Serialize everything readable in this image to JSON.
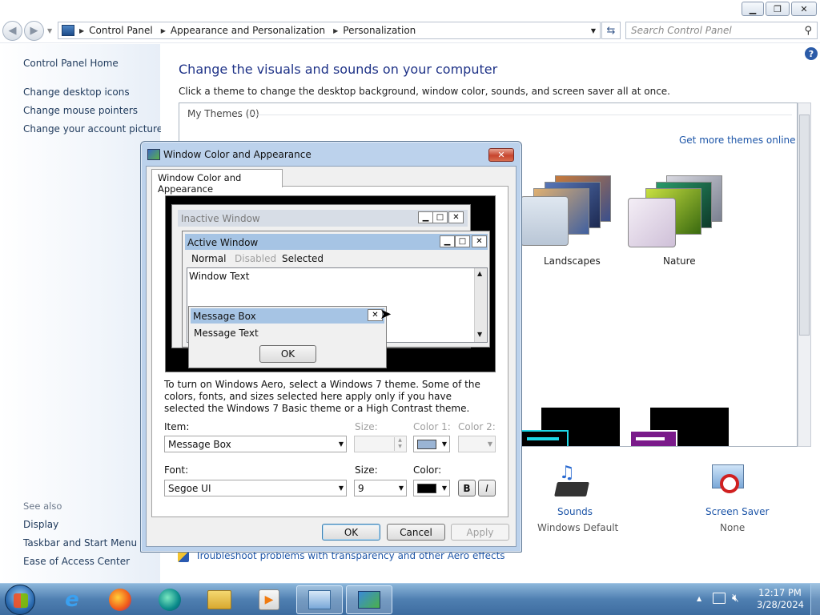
{
  "breadcrumb": [
    "Control Panel",
    "Appearance and Personalization",
    "Personalization"
  ],
  "search": {
    "placeholder": "Search Control Panel"
  },
  "window_buttons": {
    "minimize": "▁",
    "maximize": "❐",
    "close": "✕"
  },
  "sidebar": {
    "home": "Control Panel Home",
    "links": [
      "Change desktop icons",
      "Change mouse pointers",
      "Change your account picture"
    ],
    "see_also_label": "See also",
    "see_also": [
      "Display",
      "Taskbar and Start Menu",
      "Ease of Access Center"
    ]
  },
  "main": {
    "title": "Change the visuals and sounds on your computer",
    "subtitle": "Click a theme to change the desktop background, window color, sounds, and screen saver all at once.",
    "my_themes": "My Themes (0)",
    "more_themes": "Get more themes online",
    "themes": [
      "Landscapes",
      "Nature"
    ],
    "sounds_label": "Sounds",
    "sounds_value": "Windows Default",
    "saver_label": "Screen Saver",
    "saver_value": "None",
    "troubleshoot": "Troubleshoot problems with transparency and other Aero effects"
  },
  "dialog": {
    "title": "Window Color and Appearance",
    "tab": "Window Color and Appearance",
    "preview": {
      "inactive": "Inactive Window",
      "active": "Active Window",
      "menu": [
        "Normal",
        "Disabled",
        "Selected"
      ],
      "window_text": "Window Text",
      "message_box": "Message Box",
      "message_text": "Message Text",
      "ok": "OK"
    },
    "description": "To turn on Windows Aero, select a Windows 7 theme.  Some of the colors, fonts, and sizes selected here apply only if you have selected the Windows 7 Basic theme or a High Contrast theme.",
    "item_label": "Item:",
    "item_value": "Message Box",
    "size_label": "Size:",
    "color1_label": "Color 1:",
    "color2_label": "Color 2:",
    "font_label": "Font:",
    "font_value": "Segoe UI",
    "font_size_label": "Size:",
    "font_size_value": "9",
    "color_label": "Color:",
    "bold": "B",
    "italic": "I",
    "ok": "OK",
    "cancel": "Cancel",
    "apply": "Apply"
  },
  "taskbar": {
    "time": "12:17 PM",
    "date": "3/28/2024"
  },
  "colors": {
    "accent": "#1e3287",
    "dialog_frame": "#bcd2ec",
    "active_title": "#a6c4e4",
    "color1_swatch": "#9ab4d4"
  }
}
